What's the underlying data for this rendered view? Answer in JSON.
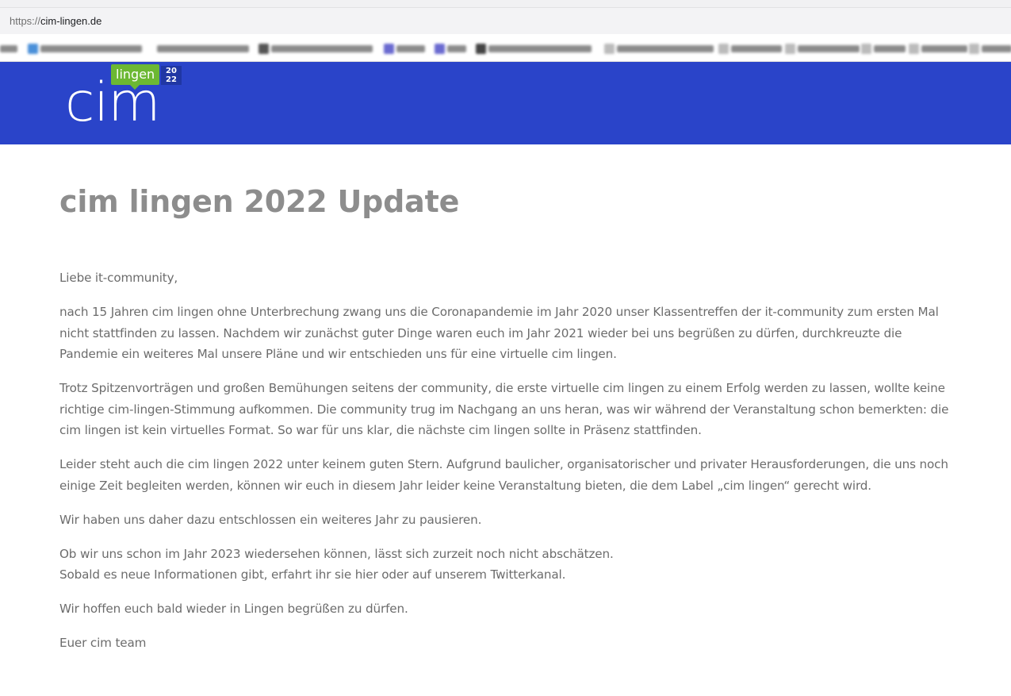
{
  "browser": {
    "url_scheme": "https://",
    "url_host": "cim-lingen.de"
  },
  "site": {
    "logo": {
      "word": "cim",
      "tag": "lingen",
      "year_top": "20",
      "year_bottom": "22"
    },
    "colors": {
      "header_bg": "#2a44c9",
      "logo_tag_green": "#6cb833",
      "title_grey": "#8d8d8d",
      "text_grey": "#6c6c6c"
    }
  },
  "article": {
    "title": "cim lingen 2022 Update",
    "greeting": "Liebe it-community,",
    "paragraphs": [
      "nach 15 Jahren cim lingen ohne Unterbrechung zwang uns die Coronapandemie im Jahr 2020 unser Klassentreffen der it-community zum ersten Mal nicht stattfinden zu lassen. Nachdem wir zunächst guter Dinge waren euch im Jahr 2021 wieder bei uns begrüßen zu dürfen, durchkreuzte die Pandemie ein weiteres Mal unsere Pläne und wir entschieden uns für eine virtuelle cim lingen.",
      "Trotz Spitzenvorträgen und großen Bemühungen seitens der community, die erste virtuelle cim lingen zu einem Erfolg werden zu lassen, wollte keine richtige cim-lingen-Stimmung aufkommen. Die community trug im Nachgang an uns heran, was wir während der Veranstaltung schon bemerkten: die cim lingen ist kein virtuelles Format. So war für uns klar, die nächste cim lingen sollte in Präsenz stattfinden.",
      "Leider steht auch die cim lingen 2022 unter keinem guten Stern. Aufgrund baulicher, organisatorischer und privater Herausforderungen, die uns noch einige Zeit begleiten werden, können wir euch in diesem Jahr leider keine Veranstaltung bieten, die dem Label „cim lingen“ gerecht wird.",
      "Wir haben uns daher dazu entschlossen ein weiteres Jahr zu pausieren."
    ],
    "outlook_line1": "Ob wir uns schon im Jahr 2023 wiedersehen können, lässt sich zurzeit noch nicht abschätzen.",
    "outlook_line2": "Sobald es neue Informationen gibt, erfahrt ihr sie hier oder auf unserem Twitterkanal.",
    "closing": "Wir hoffen euch bald wieder in Lingen begrüßen zu dürfen.",
    "signature": "Euer cim team"
  }
}
